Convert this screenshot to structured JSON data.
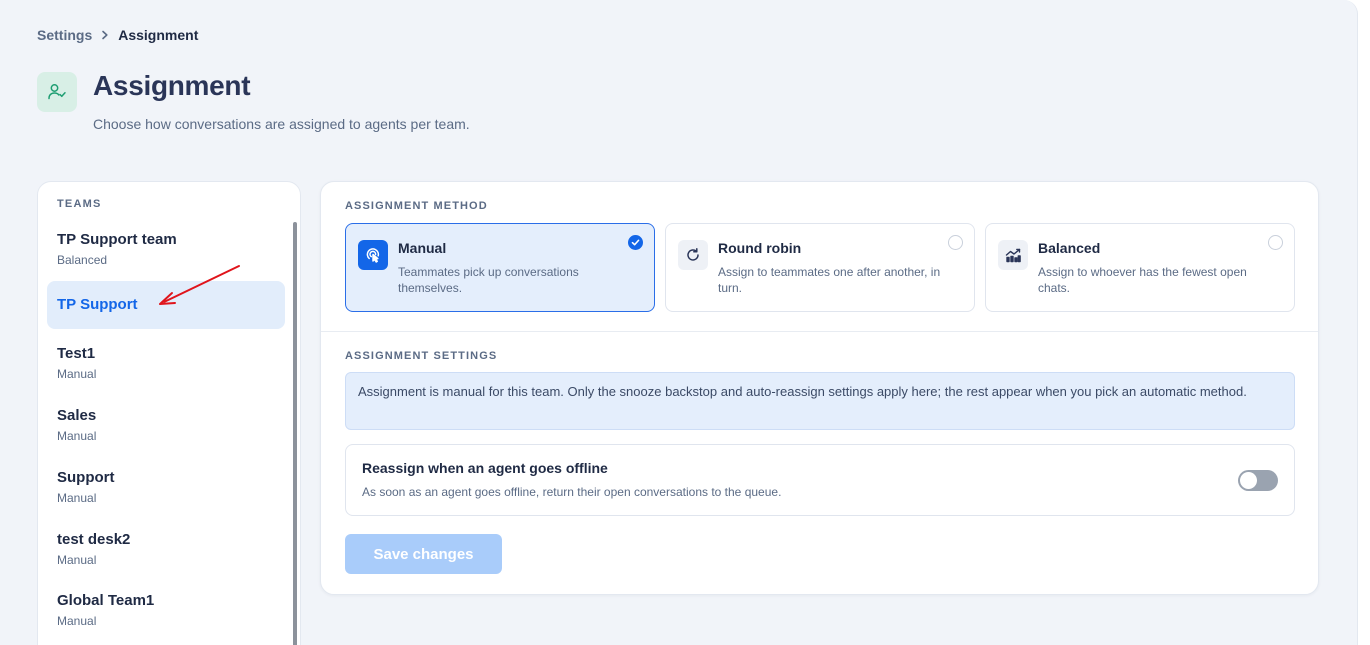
{
  "breadcrumb": {
    "parent": "Settings",
    "current": "Assignment"
  },
  "header": {
    "title": "Assignment",
    "subtitle": "Choose how conversations are assigned to agents per team.",
    "icon": "user-check-icon"
  },
  "teams": {
    "heading": "TEAMS",
    "items": [
      {
        "name": "TP Support team",
        "method": "Balanced"
      },
      {
        "name": "TP Support",
        "method": "",
        "active": true
      },
      {
        "name": "Test1",
        "method": "Manual"
      },
      {
        "name": "Sales",
        "method": "Manual"
      },
      {
        "name": "Support",
        "method": "Manual"
      },
      {
        "name": "test desk2",
        "method": "Manual"
      },
      {
        "name": "Global Team1",
        "method": "Manual"
      }
    ]
  },
  "assignment_method": {
    "label": "ASSIGNMENT METHOD",
    "options": [
      {
        "title": "Manual",
        "description": "Teammates pick up conversations themselves.",
        "icon": "hand-pointer-icon",
        "selected": true
      },
      {
        "title": "Round robin",
        "description": "Assign to teammates one after another, in turn.",
        "icon": "rotate-icon",
        "selected": false
      },
      {
        "title": "Balanced",
        "description": "Assign to whoever has the fewest open chats.",
        "icon": "balance-chart-icon",
        "selected": false
      }
    ]
  },
  "assignment_settings": {
    "label": "ASSIGNMENT SETTINGS",
    "info": "Assignment is manual for this team. Only the snooze backstop and auto-reassign settings apply here; the rest appear when you pick an automatic method.",
    "reassign": {
      "title": "Reassign when an agent goes offline",
      "description": "As soon as an agent goes offline, return their open conversations to the queue.",
      "enabled": false
    }
  },
  "actions": {
    "save_label": "Save changes"
  },
  "colors": {
    "accent": "#1366e8",
    "annotation": "#e0141b",
    "save_disabled": "#a9ccfa"
  }
}
